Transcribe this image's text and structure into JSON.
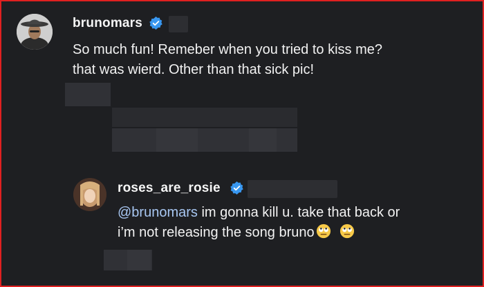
{
  "comments": [
    {
      "username": "brunomars",
      "verified": true,
      "text": "So much fun! Remeber when you tried to kiss me? that was wierd. Other than that sick pic!",
      "line1": "So much fun! Remeber when you tried to kiss me?",
      "line2": "that was wierd. Other than that sick pic!"
    },
    {
      "username": "roses_are_rosie",
      "verified": true,
      "mention": "@brunomars",
      "line1_rest": " im gonna kill u. take that back or",
      "line2": "i’m not releasing the song bruno",
      "emojis": [
        "face-with-rolling-eyes",
        "face-with-rolling-eyes"
      ]
    }
  ],
  "colors": {
    "background": "#1e1f22",
    "text": "#f2f2f2",
    "mention": "#a8c7f2",
    "verified_badge": "#3897f0",
    "frame_border": "#e02020"
  }
}
